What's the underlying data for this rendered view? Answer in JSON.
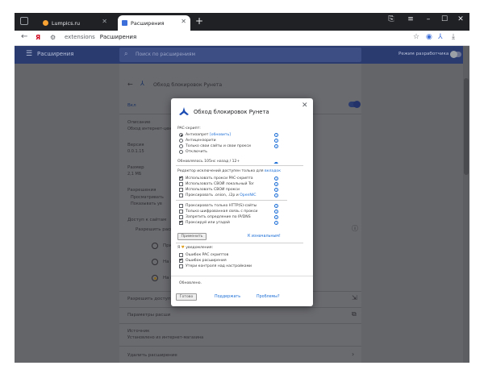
{
  "browser": {
    "tabs": [
      {
        "title": "Lumpics.ru",
        "active": false,
        "favicon_color": "#f7a233"
      },
      {
        "title": "Расширения",
        "active": true,
        "favicon_color": "#3d6fdb"
      }
    ],
    "add_tab": "+",
    "window_controls": {
      "minimize": "–",
      "maximize": "☐",
      "close": "✕"
    },
    "address": {
      "logo": "Я",
      "host": "extensions",
      "title": "Расширения"
    }
  },
  "extensions_page": {
    "header_title": "Расширения",
    "search_placeholder": "Поиск по расширениям",
    "dev_mode_label": "Режим разработчика",
    "ext_name": "Обход блокировок Рунета",
    "on_label": "Вкл",
    "desc_label": "Описание",
    "desc_value": "Обход интернет-цензуры",
    "version_label": "Версия",
    "version_value": "0.0.1.15",
    "size_label": "Размер",
    "size_value": "2,1 МБ",
    "permissions_label": "Разрешения",
    "perm_1": "Просматривать",
    "perm_2": "Показывать ув",
    "site_access_label": "Доступ к сайтам",
    "allow_label": "Разрешить расши",
    "opt_1": "При на",
    "opt_2": "На выб",
    "opt_3": "На все",
    "site_settings": "Разрешить доступ",
    "ext_params": "Параметры расши",
    "source_label": "Источник",
    "source_value": "Установлено из интернет-магазина",
    "remove_label": "Удалить расширение"
  },
  "dialog": {
    "title": "Обход блокировок Рунета",
    "pac_label": "PAC-скрипт:",
    "pac_options": [
      {
        "label": "Антизапрет",
        "extra": "[обновить]",
        "checked": true
      },
      {
        "label": "Антицензорити",
        "extra": "",
        "checked": false
      },
      {
        "label": "Только свои сайты и свои прокси",
        "extra": "",
        "checked": false
      },
      {
        "label": "Отключить",
        "extra": "",
        "checked": false
      }
    ],
    "updated_text": "Обновлялось 105нс назад / 12+",
    "editor_text": "Редактор исключений доступен только для",
    "editor_link": "вкладок",
    "options": [
      {
        "label": "Использовать прокси PAC-скрипта",
        "link": "",
        "checked": true
      },
      {
        "label": "Использовать СВОЙ локальный Tor",
        "link": "",
        "checked": false
      },
      {
        "label": "Использовать СВОИ прокси",
        "link": "",
        "checked": false
      },
      {
        "label": "Проксировать .onion, .i2p и",
        "link": "OpenNIC",
        "checked": false
      },
      {
        "label": "Проксировать только HTTP(S)-сайты",
        "link": "",
        "checked": false
      },
      {
        "label": "Только шифрованная связь с прокси",
        "link": "",
        "checked": false
      },
      {
        "label": "Запретить опредление по IP/DNS",
        "link": "",
        "checked": false
      },
      {
        "label": "Проксируй или угадай",
        "link": "",
        "checked": true
      }
    ],
    "apply_btn": "Применить",
    "defaults_link": "К изначальным!",
    "notif_prefix": "Я",
    "heart": "♥",
    "notif_suffix": "уведомления:",
    "notifs": [
      {
        "label": "Ошибок PAC скриптов",
        "checked": false
      },
      {
        "label": "Ошибок расширения",
        "checked": true
      },
      {
        "label": "Утери контроля над настройками",
        "checked": false
      }
    ],
    "status": "Обновлено.",
    "done_btn": "Готово",
    "support_link": "Поддержать",
    "problems_link": "Проблемы?"
  }
}
